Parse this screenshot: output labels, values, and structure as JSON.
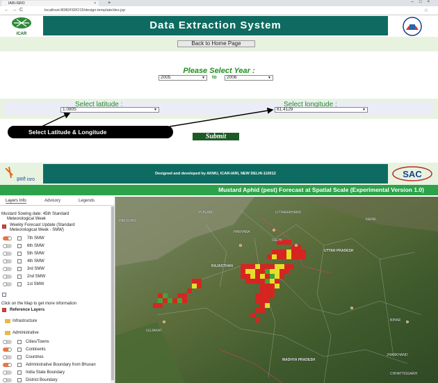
{
  "browser": {
    "tab_title": "IARI-ISRO",
    "tab_close": "×",
    "new_tab": "+",
    "window_controls": "–□×",
    "nav": "←→C",
    "url": "localhost:8080/ISRO15/design-template/des.jsp",
    "bookmark": "☆"
  },
  "header": {
    "left_logo_text": "ICAR",
    "title": "Data Extraction System",
    "home_button": "Back to Home Page"
  },
  "year": {
    "title": "Please Select Year :",
    "from": "2005",
    "to_label": "to",
    "to": "2006"
  },
  "coords": {
    "lat_label": "Select latitude :",
    "lat_value": "1.0805",
    "lon_label": "Select longitude :",
    "lon_value": "61.4129"
  },
  "callout": "Select Latitude & Longitude",
  "submit": "Submit",
  "footer": {
    "credit": "Designed and developed by AKMU, ICAR-IARI, NEW DELHI-110012",
    "isro_text": "इसरो isro",
    "sac_text": "SAC"
  },
  "mustard_bar": "Mustard Aphid (pest) Forecast at Spatial Scale (Experimental Version 1.0)",
  "panel": {
    "tabs": [
      "Layers Info",
      "Advisory",
      "Legends"
    ],
    "sowing_line1": "Mustard Sowing date: 45th Standard",
    "sowing_line2": "Meteorological Week",
    "weekly_update_1": "Weekly Forecast Update (Standard",
    "weekly_update_2": "Meteorological Week - SMW)",
    "smw_items": [
      "7th SMW",
      "6th SMW",
      "5th SMW",
      "4th SMW",
      "3rd SMW",
      "2nd SMW",
      "1st SMW"
    ],
    "click_info": "Click on the Map to get more information",
    "reference_layers": "Reference Layers",
    "infrastructure": "Infrastructure",
    "administrative": "Administrative",
    "admin_items": [
      "Cities/Towns",
      "Continents",
      "Countries",
      "Administrative Boundary from Bhuvan",
      "India State Boundary",
      "District Boundary"
    ]
  },
  "map": {
    "labels": [
      "PAKISTAN",
      "PUNJAB",
      "HARYANA",
      "UTTARAKHAND",
      "DELHI",
      "RAJASTHAN",
      "UTTAR PRADESH",
      "GUJARAT",
      "MADHYA PRADESH",
      "NEPAL",
      "BIHAR",
      "JHARKHAND",
      "CHHATTISGARH"
    ]
  },
  "colors": {
    "header_teal": "#0e6b61",
    "green_bar": "#2ea24a",
    "grid_red": "#e02020",
    "grid_yellow": "#f2e82a",
    "grid_green": "#3fa63a"
  }
}
